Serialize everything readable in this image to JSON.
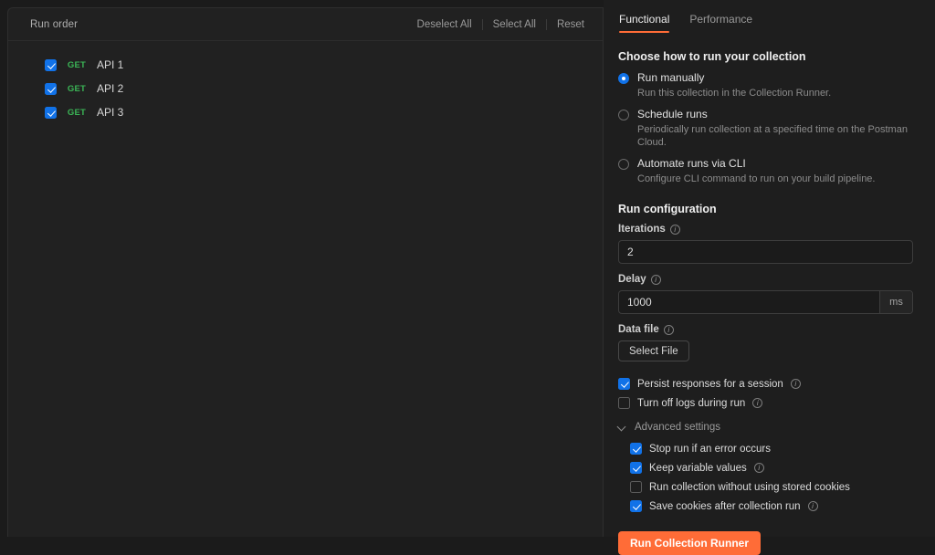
{
  "left": {
    "title": "Run order",
    "actions": [
      {
        "label": "Deselect All"
      },
      {
        "label": "Select All"
      },
      {
        "label": "Reset"
      }
    ],
    "requests": [
      {
        "method": "GET",
        "name": "API 1",
        "checked": true
      },
      {
        "method": "GET",
        "name": "API 2",
        "checked": true
      },
      {
        "method": "GET",
        "name": "API 3",
        "checked": true
      }
    ]
  },
  "right": {
    "tabs": [
      {
        "label": "Functional",
        "active": true
      },
      {
        "label": "Performance",
        "active": false
      }
    ],
    "run_mode": {
      "heading": "Choose how to run your collection",
      "options": [
        {
          "label": "Run manually",
          "desc": "Run this collection in the Collection Runner.",
          "selected": true
        },
        {
          "label": "Schedule runs",
          "desc": "Periodically run collection at a specified time on the Postman Cloud.",
          "selected": false
        },
        {
          "label": "Automate runs via CLI",
          "desc": "Configure CLI command to run on your build pipeline.",
          "selected": false
        }
      ]
    },
    "run_config": {
      "heading": "Run configuration",
      "iterations": {
        "label": "Iterations",
        "value": "2"
      },
      "delay": {
        "label": "Delay",
        "value": "1000",
        "suffix": "ms"
      },
      "data_file": {
        "label": "Data file",
        "button": "Select File"
      }
    },
    "options": [
      {
        "label": "Persist responses for a session",
        "checked": true,
        "info": true
      },
      {
        "label": "Turn off logs during run",
        "checked": false,
        "info": true
      }
    ],
    "advanced": {
      "label": "Advanced settings",
      "expanded": true,
      "options": [
        {
          "label": "Stop run if an error occurs",
          "checked": true,
          "info": false
        },
        {
          "label": "Keep variable values",
          "checked": true,
          "info": true
        },
        {
          "label": "Run collection without using stored cookies",
          "checked": false,
          "info": false
        },
        {
          "label": "Save cookies after collection run",
          "checked": true,
          "info": true
        }
      ]
    },
    "run_button": "Run Collection Runner"
  },
  "colors": {
    "accent": "#ff6c37",
    "checkbox": "#1172e8",
    "method_get": "#3bb556"
  }
}
